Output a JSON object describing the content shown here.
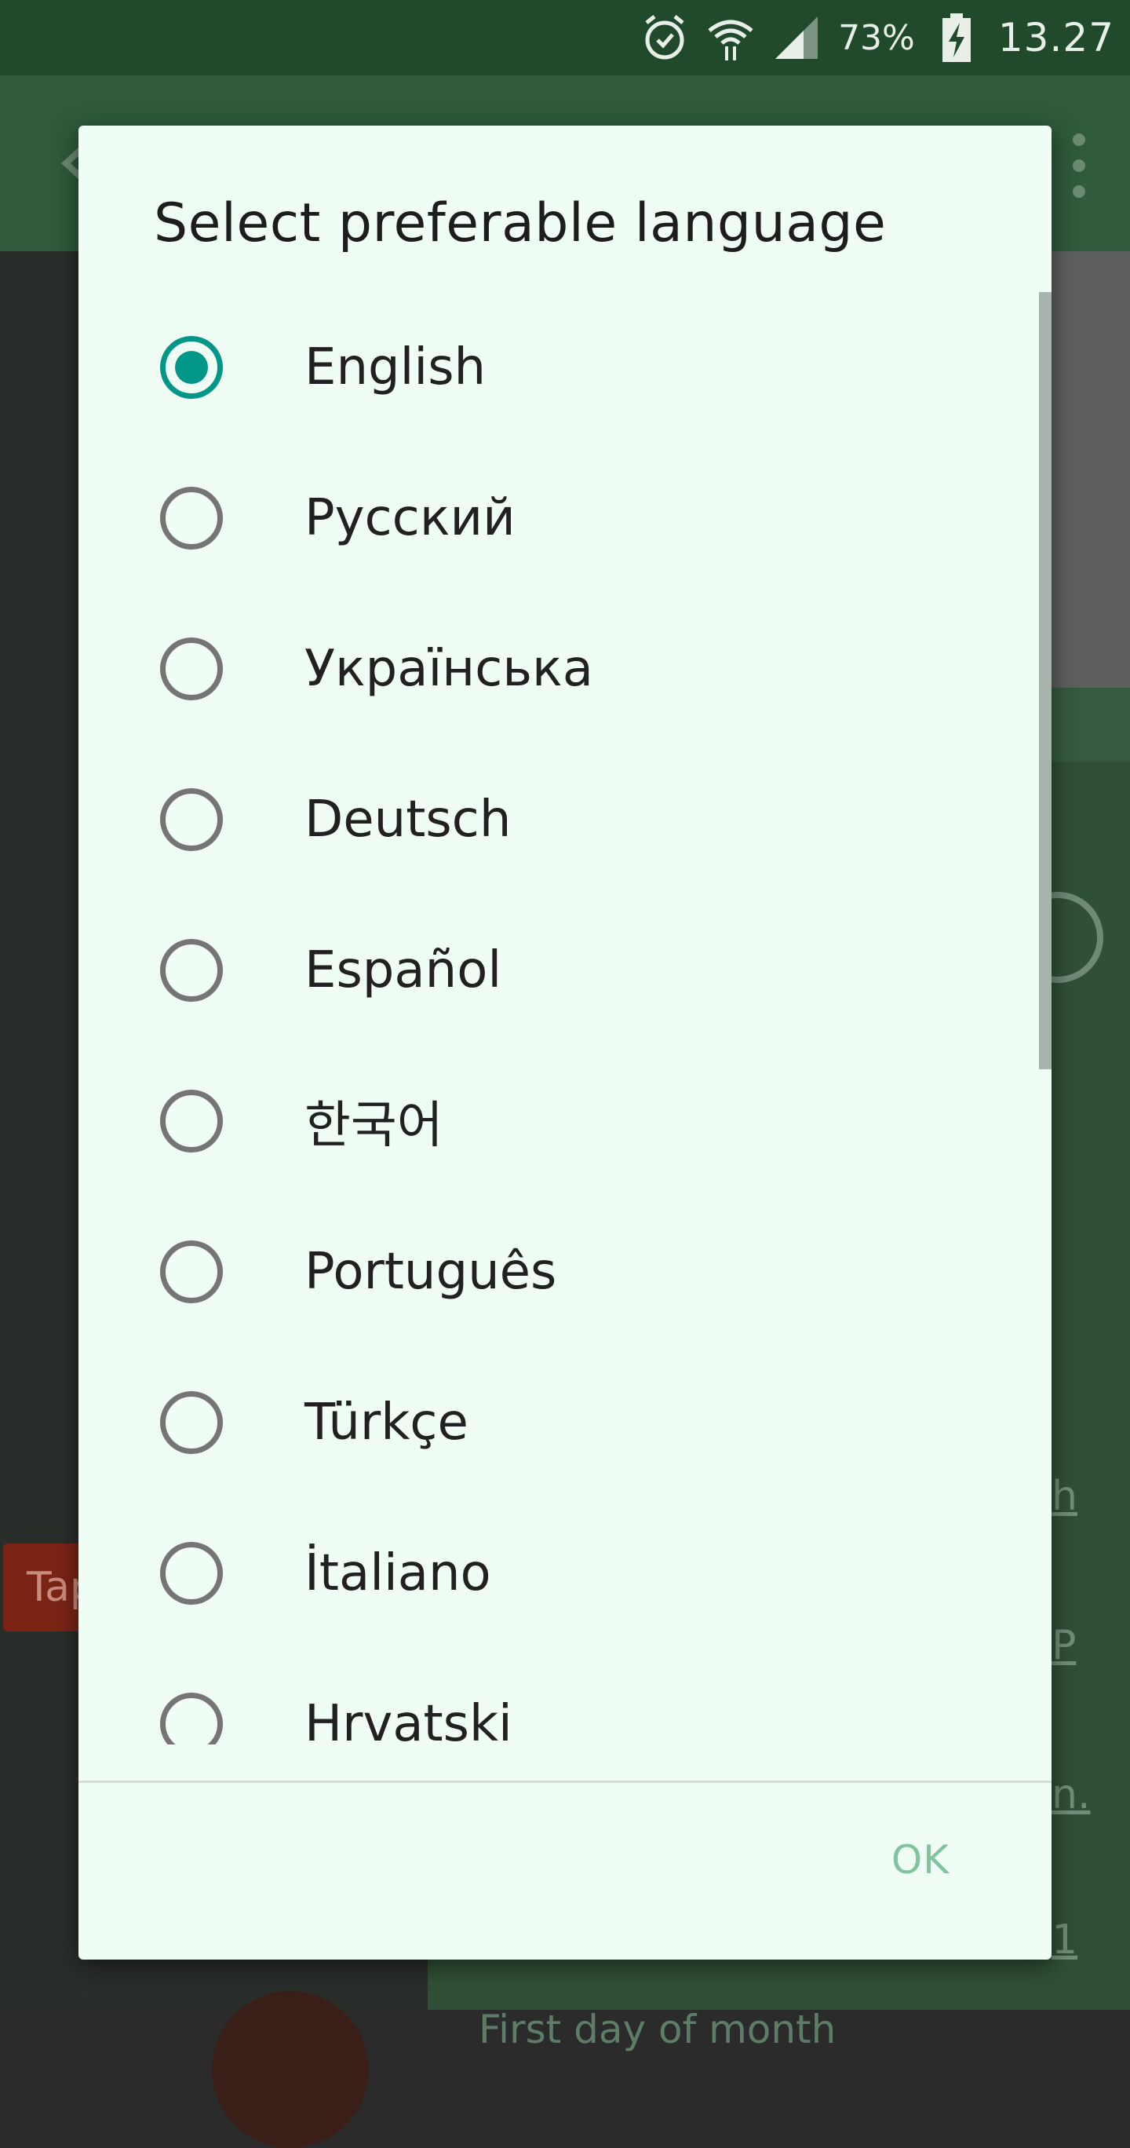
{
  "status_bar": {
    "battery_percent": "73%",
    "time": "13.27",
    "icons": [
      "alarm-icon",
      "wifi-icon",
      "signal-icon",
      "battery-charging-icon"
    ]
  },
  "background_app": {
    "button_fragment": "Tap",
    "link_fragments": [
      "h",
      "P",
      "n.",
      "1"
    ],
    "footer_label": "First day of month"
  },
  "dialog": {
    "title": "Select preferable language",
    "options": [
      {
        "label": "English",
        "selected": true
      },
      {
        "label": "Русский",
        "selected": false
      },
      {
        "label": "Українська",
        "selected": false
      },
      {
        "label": "Deutsch",
        "selected": false
      },
      {
        "label": "Español",
        "selected": false
      },
      {
        "label": "한국어",
        "selected": false
      },
      {
        "label": "Português",
        "selected": false
      },
      {
        "label": "Türkçe",
        "selected": false
      },
      {
        "label": "İtaliano",
        "selected": false
      },
      {
        "label": "Hrvatski",
        "selected": false
      }
    ],
    "ok_label": "OK"
  },
  "colors": {
    "accent": "#009688",
    "dialog_bg": "#f0fdf4",
    "status_bar_bg": "#214a2c",
    "ok_text": "#7fc49d"
  }
}
